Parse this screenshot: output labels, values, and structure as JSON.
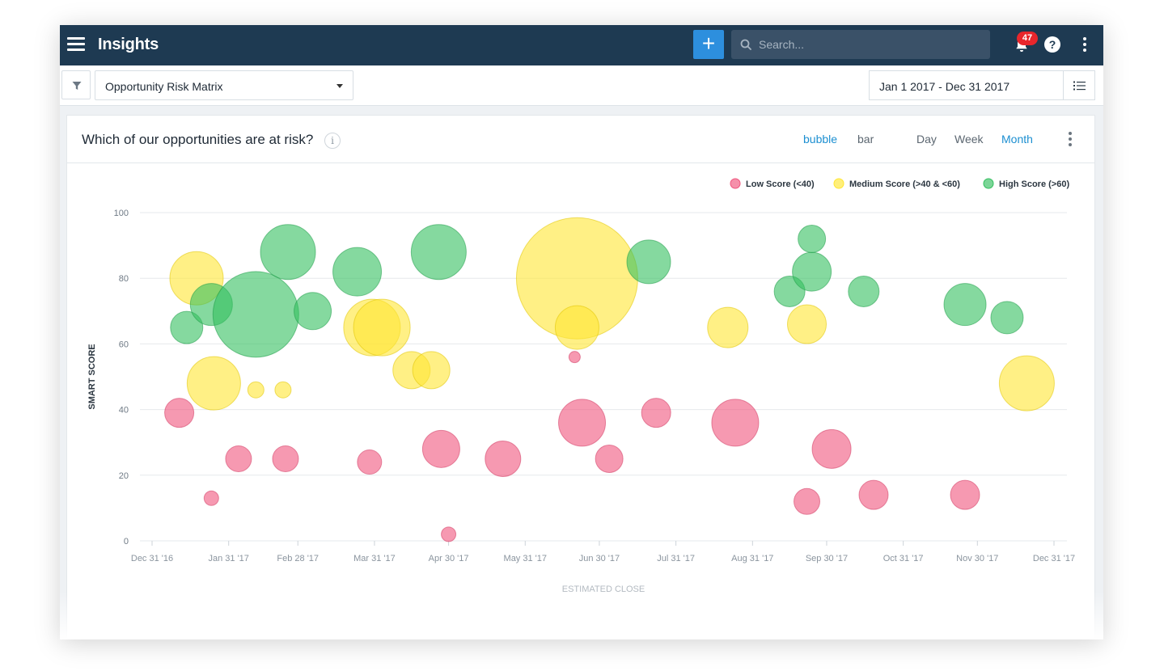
{
  "app": {
    "title": "Insights"
  },
  "search": {
    "placeholder": "Search..."
  },
  "notifications": {
    "count": "47"
  },
  "filterbar": {
    "report_name": "Opportunity Risk Matrix",
    "date_range": "Jan 1 2017 - Dec 31 2017"
  },
  "card": {
    "title": "Which of our opportunities are at risk?",
    "info": "i",
    "chart_types": [
      "bubble",
      "bar"
    ],
    "active_chart_type": "bubble",
    "periods": [
      "Day",
      "Week",
      "Month"
    ],
    "active_period": "Month"
  },
  "colors": {
    "topbar": "#1e3a52",
    "accent": "#2d8fde",
    "low": "#f0557d",
    "medium": "#ffe633",
    "high": "#34bf5f"
  },
  "icons": [
    "menu-icon",
    "plus-icon",
    "search-icon",
    "bell-icon",
    "help-icon",
    "more-vertical-icon",
    "filter-icon",
    "chevron-down-icon",
    "list-icon",
    "info-icon"
  ],
  "chart_data": {
    "type": "bubble",
    "xlabel": "ESTIMATED CLOSE",
    "ylabel": "SMART SCORE",
    "ylim": [
      0,
      100
    ],
    "yticks": [
      0,
      20,
      40,
      60,
      80,
      100
    ],
    "xlim": [
      "2016-12-31",
      "2017-12-31"
    ],
    "xticks": [
      "Dec 31 '16",
      "Jan 31 '17",
      "Feb 28 '17",
      "Mar 31 '17",
      "Apr 30 '17",
      "May 31 '17",
      "Jun 30 '17",
      "Jul 31 '17",
      "Aug 31 '17",
      "Sep 30 '17",
      "Oct 31 '17",
      "Nov 30 '17",
      "Dec 31 '17"
    ],
    "xtick_dates": [
      "2016-12-31",
      "2017-01-31",
      "2017-02-28",
      "2017-03-31",
      "2017-04-30",
      "2017-05-31",
      "2017-06-30",
      "2017-07-31",
      "2017-08-31",
      "2017-09-30",
      "2017-10-31",
      "2017-11-30",
      "2017-12-31"
    ],
    "grid": true,
    "legend_position": "top-right",
    "series": [
      {
        "name": "Low Score (<40)",
        "color": "#f0557d",
        "points": [
          {
            "x": "2017-01-11",
            "y": 39,
            "r": 18
          },
          {
            "x": "2017-01-24",
            "y": 13,
            "r": 9
          },
          {
            "x": "2017-02-04",
            "y": 25,
            "r": 16
          },
          {
            "x": "2017-02-23",
            "y": 25,
            "r": 16
          },
          {
            "x": "2017-03-29",
            "y": 24,
            "r": 15
          },
          {
            "x": "2017-04-27",
            "y": 28,
            "r": 23
          },
          {
            "x": "2017-04-30",
            "y": 2,
            "r": 9
          },
          {
            "x": "2017-05-22",
            "y": 25,
            "r": 22
          },
          {
            "x": "2017-06-20",
            "y": 56,
            "r": 7
          },
          {
            "x": "2017-06-23",
            "y": 36,
            "r": 29
          },
          {
            "x": "2017-07-04",
            "y": 25,
            "r": 17
          },
          {
            "x": "2017-07-23",
            "y": 39,
            "r": 18
          },
          {
            "x": "2017-08-24",
            "y": 36,
            "r": 29
          },
          {
            "x": "2017-09-22",
            "y": 12,
            "r": 16
          },
          {
            "x": "2017-10-02",
            "y": 28,
            "r": 24
          },
          {
            "x": "2017-10-19",
            "y": 14,
            "r": 18
          },
          {
            "x": "2017-11-25",
            "y": 14,
            "r": 18
          }
        ]
      },
      {
        "name": "Medium Score (>40 & <60)",
        "color": "#ffe633",
        "points": [
          {
            "x": "2017-01-18",
            "y": 80,
            "r": 33
          },
          {
            "x": "2017-01-25",
            "y": 48,
            "r": 33
          },
          {
            "x": "2017-02-11",
            "y": 46,
            "r": 10
          },
          {
            "x": "2017-02-22",
            "y": 46,
            "r": 10
          },
          {
            "x": "2017-03-30",
            "y": 65,
            "r": 35
          },
          {
            "x": "2017-04-03",
            "y": 65,
            "r": 35
          },
          {
            "x": "2017-04-15",
            "y": 52,
            "r": 23
          },
          {
            "x": "2017-04-23",
            "y": 52,
            "r": 23
          },
          {
            "x": "2017-06-21",
            "y": 80,
            "r": 75
          },
          {
            "x": "2017-06-21",
            "y": 65,
            "r": 27
          },
          {
            "x": "2017-08-21",
            "y": 65,
            "r": 25
          },
          {
            "x": "2017-09-22",
            "y": 66,
            "r": 24
          },
          {
            "x": "2017-12-20",
            "y": 48,
            "r": 34
          }
        ]
      },
      {
        "name": "High Score (>60)",
        "color": "#34bf5f",
        "points": [
          {
            "x": "2017-01-14",
            "y": 65,
            "r": 20
          },
          {
            "x": "2017-01-24",
            "y": 72,
            "r": 26
          },
          {
            "x": "2017-02-11",
            "y": 69,
            "r": 53
          },
          {
            "x": "2017-02-24",
            "y": 88,
            "r": 34
          },
          {
            "x": "2017-03-06",
            "y": 70,
            "r": 23
          },
          {
            "x": "2017-03-24",
            "y": 82,
            "r": 30
          },
          {
            "x": "2017-04-26",
            "y": 88,
            "r": 34
          },
          {
            "x": "2017-07-20",
            "y": 85,
            "r": 27
          },
          {
            "x": "2017-09-15",
            "y": 76,
            "r": 19
          },
          {
            "x": "2017-09-24",
            "y": 82,
            "r": 24
          },
          {
            "x": "2017-09-24",
            "y": 92,
            "r": 17
          },
          {
            "x": "2017-10-15",
            "y": 76,
            "r": 19
          },
          {
            "x": "2017-11-25",
            "y": 72,
            "r": 26
          },
          {
            "x": "2017-12-12",
            "y": 68,
            "r": 20
          }
        ]
      }
    ]
  }
}
